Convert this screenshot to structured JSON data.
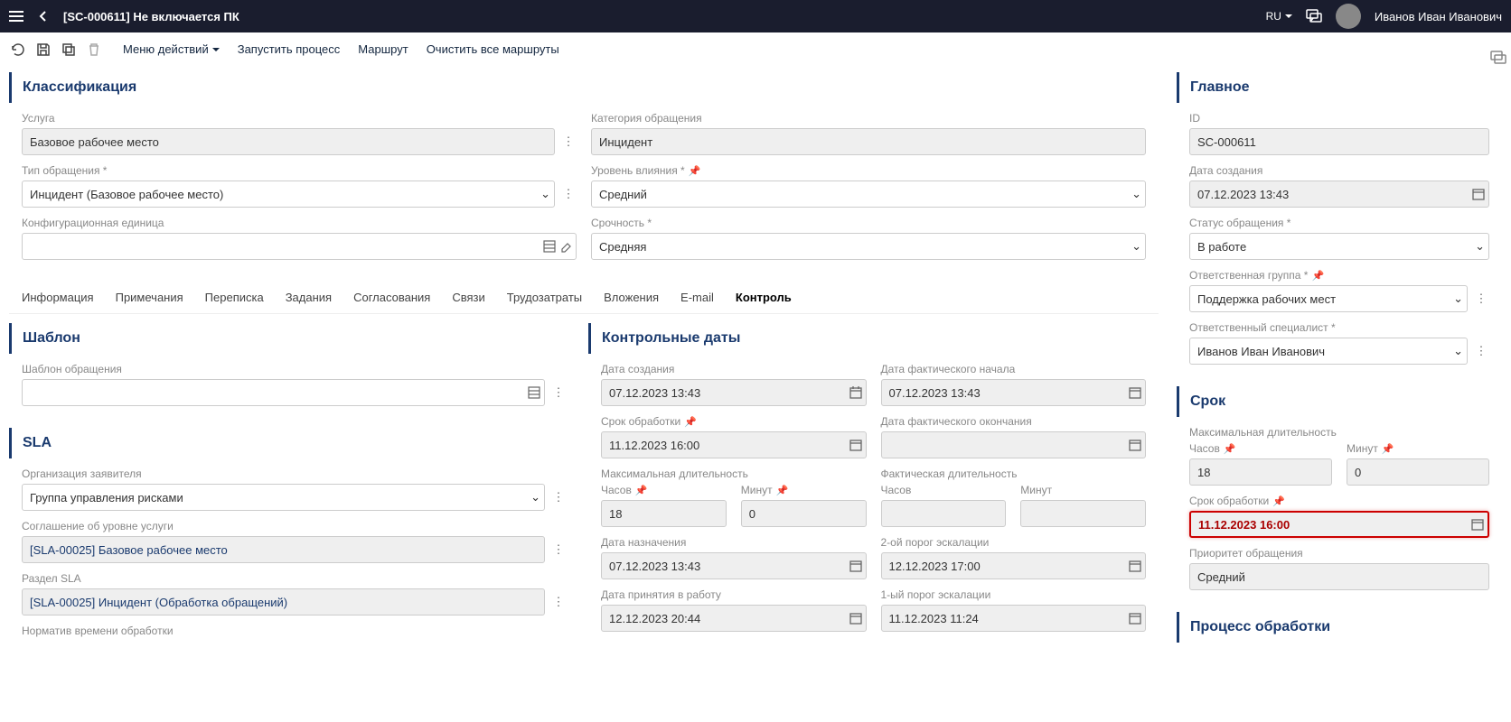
{
  "header": {
    "title": "[SC-000611] Не включается ПК",
    "language": "RU",
    "user_name": "Иванов Иван Иванович"
  },
  "toolbar": {
    "actions_menu": "Меню действий",
    "start_process": "Запустить процесс",
    "route": "Маршрут",
    "clear_routes": "Очистить все маршруты"
  },
  "classification": {
    "title": "Классификация",
    "service_label": "Услуга",
    "service_value": "Базовое рабочее место",
    "category_label": "Категория обращения",
    "category_value": "Инцидент",
    "request_type_label": "Тип обращения *",
    "request_type_value": "Инцидент (Базовое рабочее место)",
    "impact_label": "Уровень влияния *",
    "impact_value": "Средний",
    "ci_label": "Конфигурационная единица",
    "ci_value": "",
    "urgency_label": "Срочность *",
    "urgency_value": "Средняя"
  },
  "tabs": {
    "info": "Информация",
    "notes": "Примечания",
    "correspondence": "Переписка",
    "tasks": "Задания",
    "approvals": "Согласования",
    "links": "Связи",
    "time": "Трудозатраты",
    "attachments": "Вложения",
    "email": "E-mail",
    "control": "Контроль"
  },
  "template": {
    "title": "Шаблон",
    "label": "Шаблон обращения",
    "value": ""
  },
  "sla": {
    "title": "SLA",
    "org_label": "Организация заявителя",
    "org_value": "Группа управления рисками",
    "agreement_label": "Соглашение об уровне услуги",
    "agreement_value": "[SLA-00025] Базовое рабочее место",
    "section_label": "Раздел SLA",
    "section_value": "[SLA-00025] Инцидент (Обработка обращений)",
    "norm_label": "Норматив времени обработки"
  },
  "control_dates": {
    "title": "Контрольные даты",
    "created_label": "Дата создания",
    "created_value": "07.12.2023 13:43",
    "actual_start_label": "Дата фактического начала",
    "actual_start_value": "07.12.2023 13:43",
    "due_label": "Срок обработки",
    "due_value": "11.12.2023 16:00",
    "actual_end_label": "Дата фактического окончания",
    "actual_end_value": "",
    "max_duration_label": "Максимальная длительность",
    "actual_duration_label": "Фактическая длительность",
    "hours_label": "Часов",
    "hours_value": "18",
    "minutes_label": "Минут",
    "minutes_value": "0",
    "act_hours_value": "",
    "act_minutes_value": "",
    "assigned_label": "Дата назначения",
    "assigned_value": "07.12.2023 13:43",
    "escalation2_label": "2-ой порог эскалации",
    "escalation2_value": "12.12.2023 17:00",
    "accepted_label": "Дата принятия в работу",
    "accepted_value": "12.12.2023 20:44",
    "escalation1_label": "1-ый порог эскалации",
    "escalation1_value": "11.12.2023 11:24"
  },
  "main": {
    "title": "Главное",
    "id_label": "ID",
    "id_value": "SC-000611",
    "created_label": "Дата создания",
    "created_value": "07.12.2023 13:43",
    "status_label": "Статус обращения *",
    "status_value": "В работе",
    "group_label": "Ответственная группа *",
    "group_value": "Поддержка рабочих мест",
    "specialist_label": "Ответственный специалист *",
    "specialist_value": "Иванов Иван Иванович"
  },
  "deadline": {
    "title": "Срок",
    "max_duration_label": "Максимальная длительность",
    "hours_label": "Часов",
    "hours_value": "18",
    "minutes_label": "Минут",
    "minutes_value": "0",
    "due_label": "Срок обработки",
    "due_value": "11.12.2023 16:00",
    "priority_label": "Приоритет обращения",
    "priority_value": "Средний"
  },
  "processing": {
    "title": "Процесс обработки"
  }
}
